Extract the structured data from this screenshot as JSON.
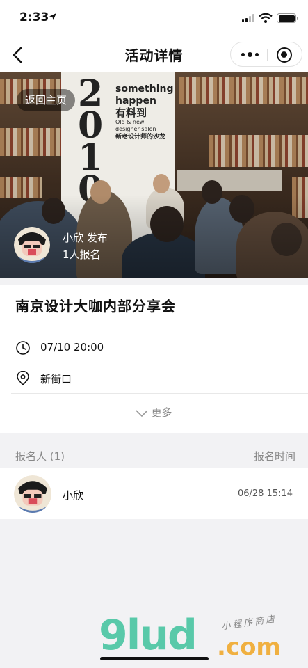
{
  "status": {
    "time": "2:33"
  },
  "nav": {
    "title": "活动详情"
  },
  "banner": {
    "home_label": "返回主页",
    "poster_year": "2010",
    "poster_lines": [
      "something",
      "happen",
      "有料到",
      "Old & new",
      "designer salon",
      "新老设计师的沙龙"
    ],
    "publisher": "小欣 发布",
    "signup_count": "1人报名"
  },
  "event": {
    "title": "南京设计大咖内部分享会",
    "datetime": "07/10 20:00",
    "location": "新街口",
    "more_label": "更多"
  },
  "attendees_section": {
    "header_left": "报名人 (1)",
    "header_right": "报名时间",
    "items": [
      {
        "name": "小欣",
        "time": "06/28 15:14"
      }
    ]
  },
  "watermark": {
    "logo": "9lud",
    "suffix": ".com",
    "tagline": "小程序商店"
  }
}
